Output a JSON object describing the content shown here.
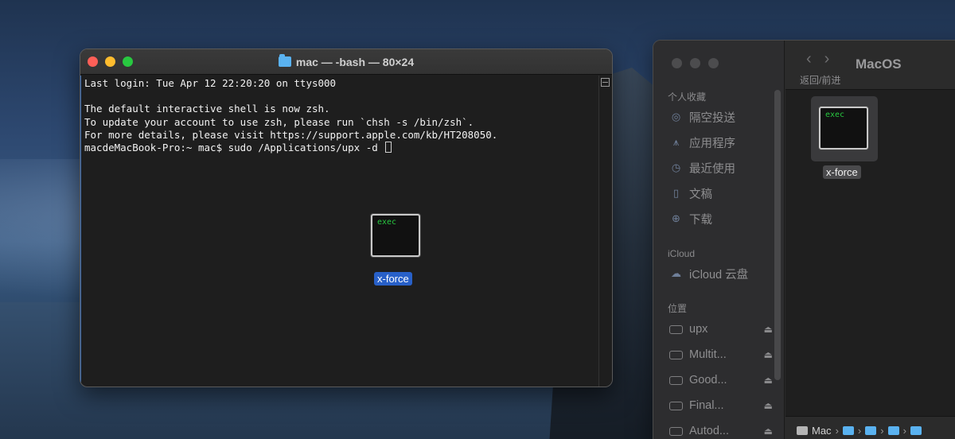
{
  "terminal": {
    "title": "mac — -bash — 80×24",
    "lines": [
      "Last login: Tue Apr 12 22:20:20 on ttys000",
      "",
      "The default interactive shell is now zsh.",
      "To update your account to use zsh, please run `chsh -s /bin/zsh`.",
      "For more details, please visit https://support.apple.com/kb/HT208050.",
      "macdeMacBook-Pro:~ mac$ sudo /Applications/upx -d "
    ],
    "dragged_icon_text": "exec",
    "dragged_icon_label": "x-force"
  },
  "finder": {
    "nav_caption": "返回/前进",
    "folder_title": "MacOS",
    "sections": {
      "favorites": "个人收藏",
      "icloud": "iCloud",
      "locations": "位置"
    },
    "favorites": [
      {
        "label": "隔空投送",
        "icon": "airdrop-icon",
        "glyph": "◎"
      },
      {
        "label": "应用程序",
        "icon": "applications-icon",
        "glyph": "⩚"
      },
      {
        "label": "最近使用",
        "icon": "recents-icon",
        "glyph": "◷"
      },
      {
        "label": "文稿",
        "icon": "document-icon",
        "glyph": "▯"
      },
      {
        "label": "下载",
        "icon": "download-icon",
        "glyph": "⊕"
      }
    ],
    "icloud_items": [
      {
        "label": "iCloud 云盘",
        "icon": "cloud-icon",
        "glyph": "☁"
      }
    ],
    "locations": [
      {
        "label": "upx"
      },
      {
        "label": "Multit..."
      },
      {
        "label": "Good..."
      },
      {
        "label": "Final..."
      },
      {
        "label": "Autod..."
      }
    ],
    "eject_glyph": "⏏",
    "file": {
      "icon_text": "exec",
      "label": "x-force"
    },
    "pathbar": {
      "root": "Mac"
    }
  }
}
